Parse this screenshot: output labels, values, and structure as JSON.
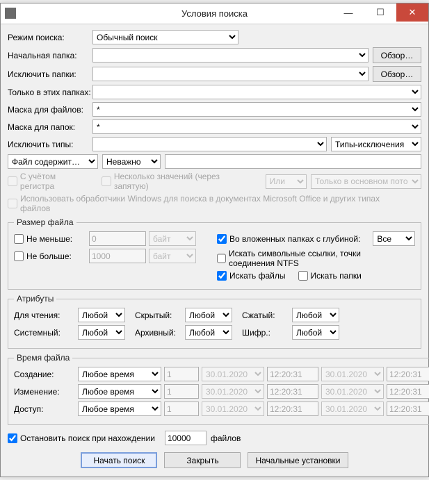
{
  "title": "Условия поиска",
  "labels": {
    "mode": "Режим поиска:",
    "startFolder": "Начальная папка:",
    "excludeFolders": "Исключить папки:",
    "onlyInFolders": "Только в этих папках:",
    "fileMask": "Маска для файлов:",
    "folderMask": "Маска для папок:",
    "excludeTypes": "Исключить типы:"
  },
  "mode": {
    "value": "Обычный поиск"
  },
  "browse": "Обзор…",
  "fileMaskVal": "*",
  "folderMaskVal": "*",
  "excludeTypesList": "Типы-исключения",
  "contains": {
    "label": "Файл содержит…",
    "case": "Неважно"
  },
  "opts": {
    "caseSensitive": "С учётом регистра",
    "multiValues": "Несколько значений (через запятую)",
    "logic": "Или",
    "onlyInMain": "Только в основном пото",
    "useHandlers": "Использовать обработчики Windows для поиска в документах Microsoft Office и других типах файлов"
  },
  "size": {
    "legend": "Размер файла",
    "min": "Не меньше:",
    "minVal": "0",
    "max": "Не больше:",
    "maxVal": "1000",
    "unit": "байт",
    "subfolders": "Во вложенных папках с глубиной:",
    "depth": "Все",
    "symlinks": "Искать символьные ссылки, точки соединения NTFS",
    "findFiles": "Искать файлы",
    "findFolders": "Искать папки"
  },
  "attr": {
    "legend": "Атрибуты",
    "readonly": "Для чтения:",
    "system": "Системный:",
    "hidden": "Скрытый:",
    "archive": "Архивный:",
    "compressed": "Сжатый:",
    "encrypted": "Шифр.:",
    "any": "Любой"
  },
  "timef": {
    "legend": "Время файла",
    "created": "Создание:",
    "modified": "Изменение:",
    "accessed": "Доступ:",
    "anytime": "Любое время",
    "n": "1",
    "date": "30.01.2020",
    "time": "12:20:31"
  },
  "stop": {
    "label": "Остановить поиск при нахождении",
    "val": "10000",
    "suffix": "файлов"
  },
  "buttons": {
    "start": "Начать поиск",
    "close": "Закрыть",
    "defaults": "Начальные установки"
  }
}
